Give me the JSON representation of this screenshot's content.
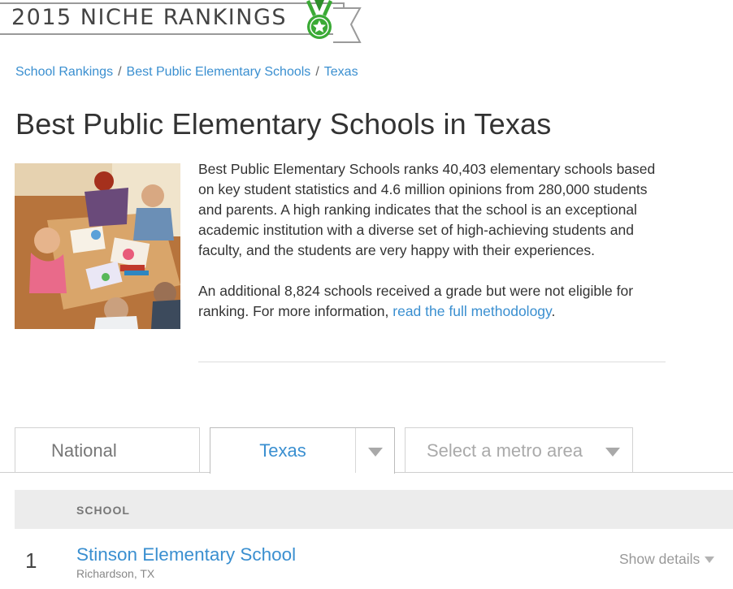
{
  "banner": {
    "text": "2015 NICHE RANKINGS",
    "accent_color": "#3aaa35",
    "medal_icon": "medal-star-icon"
  },
  "breadcrumb": [
    {
      "label": "School Rankings"
    },
    {
      "label": "Best Public Elementary Schools"
    },
    {
      "label": "Texas"
    }
  ],
  "breadcrumb_separator": "/",
  "page_title": "Best Public Elementary Schools in Texas",
  "hero_image": {
    "icon": "classroom-photo"
  },
  "description": {
    "paragraph1": "Best Public Elementary Schools ranks 40,403 elementary schools based on key student statistics and 4.6 million opinions from 280,000 students and parents. A high ranking indicates that the school is an exceptional academic institution with a diverse set of high-achieving students and faculty, and the students are very happy with their experiences.",
    "paragraph2_prefix": "An additional 8,824 schools received a grade but were not eligible for ranking. For more information, ",
    "paragraph2_link": "read the full methodology",
    "paragraph2_suffix": "."
  },
  "tabs": {
    "national": "National",
    "state": "Texas",
    "metro_placeholder": "Select a metro area"
  },
  "table": {
    "column_school": "SCHOOL",
    "rows": [
      {
        "rank": "1",
        "name": "Stinson Elementary School",
        "location": "Richardson, TX",
        "details_label": "Show details"
      }
    ]
  },
  "colors": {
    "link": "#3a8fd0",
    "header_bg": "#ececec"
  }
}
